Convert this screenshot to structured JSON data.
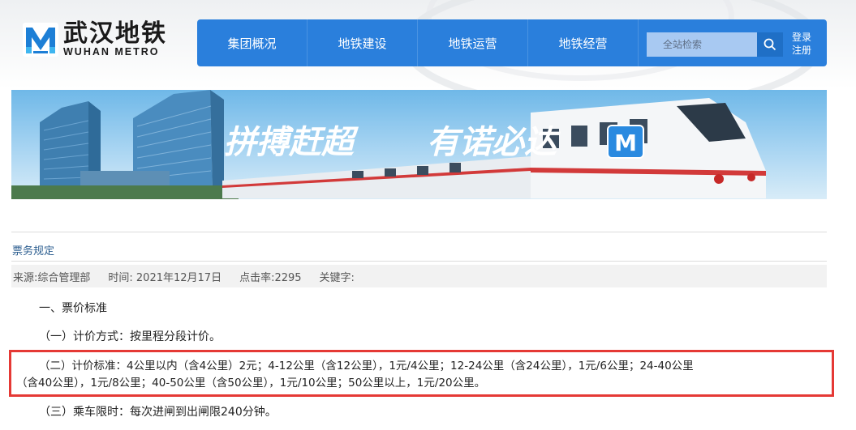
{
  "logo": {
    "cn": "武汉地铁",
    "en": "WUHAN METRO"
  },
  "nav": {
    "items": [
      "集团概况",
      "地铁建设",
      "地铁运营",
      "地铁经营"
    ],
    "search_placeholder": "全站检索",
    "login": "登录",
    "register": "注册"
  },
  "banner": {
    "slogan_left": "拼搏赶超",
    "slogan_right": "有诺必达",
    "badge": "M"
  },
  "article": {
    "category": "票务规定",
    "meta": {
      "source": "来源:综合管理部",
      "time": "时间: 2021年12月17日",
      "clicks": "点击率:2295",
      "keywords": "关键字:"
    },
    "section1": "一、票价标准",
    "item1": "（一）计价方式：按里程分段计价。",
    "item2_line1": "（二）计价标准：4公里以内（含4公里）2元；4-12公里（含12公里），1元/4公里；12-24公里（含24公里），1元/6公里；24-40公里",
    "item2_line2": "（含40公里），1元/8公里；40-50公里（含50公里），1元/10公里；50公里以上，1元/20公里。",
    "item3": "（三）乘车限时：每次进闸到出闸限240分钟。"
  },
  "colors": {
    "nav_blue": "#2a7fdc",
    "highlight_red": "#e53935",
    "category_link": "#2b5d8f"
  }
}
